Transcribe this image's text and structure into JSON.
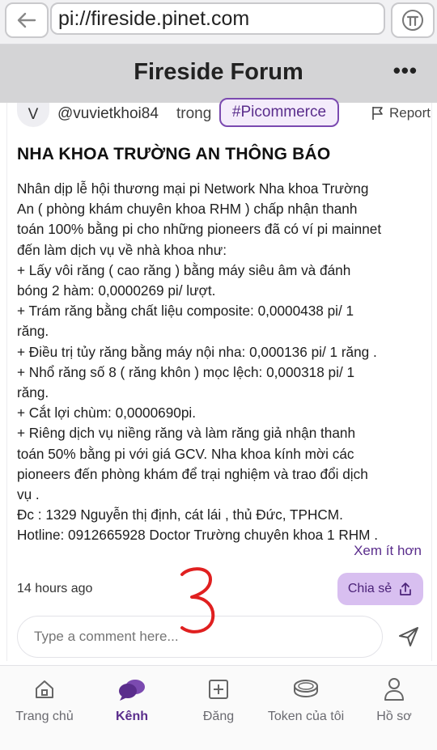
{
  "browser": {
    "url": "pi://fireside.pinet.com"
  },
  "header": {
    "title": "Fireside Forum",
    "more_label": "•••"
  },
  "post": {
    "avatar_initial": "V",
    "author": "@vuvietkhoi84",
    "in_label": "trong",
    "tag": "#Picommerce",
    "report_label": "Report",
    "title": "NHA KHOA TRƯỜNG AN THÔNG BÁO",
    "body_lines": [
      "Nhân dịp lễ hội thương mại pi Network Nha khoa Trường",
      "An ( phòng khám chuyên khoa RHM ) chấp nhận thanh",
      "toán 100% bằng pi cho những pioneers đã có ví pi mainnet",
      "đến làm dịch vụ về nhà khoa như:",
      "+ Lấy vôi răng ( cao răng ) bằng máy siêu âm và đánh",
      "bóng 2 hàm: 0,0000269 pi/ lượt.",
      "+ Trám răng bằng chất liệu composite: 0,0000438 pi/ 1",
      "răng.",
      "+ Điều trị tủy răng bằng máy nội nha: 0,000136 pi/ 1 răng .",
      "+ Nhổ răng số 8 ( răng khôn ) mọc lệch: 0,000318 pi/ 1",
      "răng.",
      "+ Cắt lợi chùm: 0,0000690pi.",
      "+ Riêng dịch vụ niềng răng và làm răng giả nhận thanh",
      "toán 50% bằng pi với giá GCV. Nha khoa kính mời các",
      "pioneers đến phòng khám để trại nghiệm và trao đổi dịch",
      "vụ .",
      "Đc : 1329 Nguyễn thị định, cát lái , thủ Đức, TPHCM.",
      "Hotline: 0912665928 Doctor Trường chuyên khoa 1 RHM ."
    ],
    "see_less": "Xem ít hơn",
    "timestamp": "14 hours ago",
    "share_label": "Chia sẻ",
    "comment_placeholder": "Type a comment here..."
  },
  "annotation_text": "3",
  "nav": {
    "items": [
      {
        "label": "Trang chủ",
        "icon": "home-icon"
      },
      {
        "label": "Kênh",
        "icon": "chat-bubbles-icon"
      },
      {
        "label": "Đăng",
        "icon": "plus-square-icon"
      },
      {
        "label": "Token của tôi",
        "icon": "coin-stack-icon"
      },
      {
        "label": "Hồ sơ",
        "icon": "profile-icon"
      }
    ]
  },
  "colors": {
    "accent": "#5a2d8c",
    "share_bg": "#d8bff0",
    "header_bg": "#d4d4d6"
  }
}
